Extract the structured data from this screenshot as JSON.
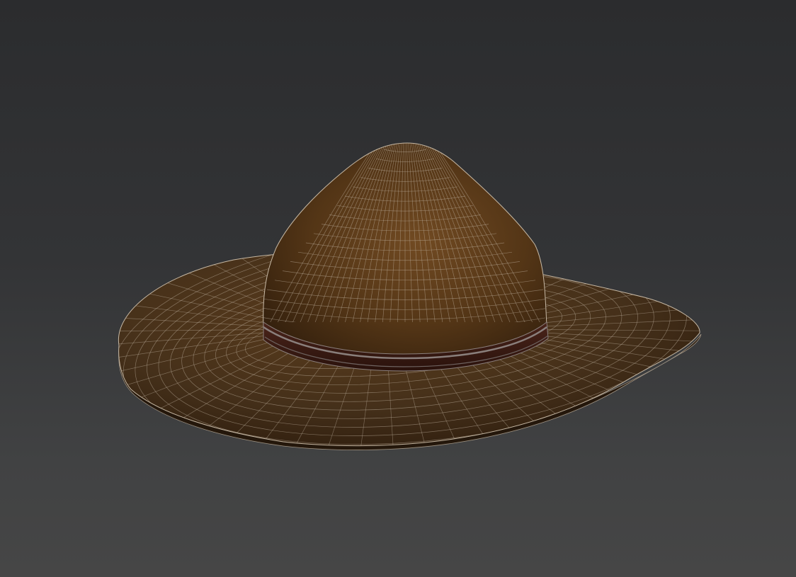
{
  "viewport": {
    "background_top": "#2b2c2e",
    "background_bottom": "#464646"
  },
  "model": {
    "object": "campaign-hat",
    "display_mode": "shaded-wireframe",
    "colors": {
      "crown_light": "#6a4520",
      "crown_base": "#4a2f14",
      "crown_dark": "#2f1d0c",
      "brim_top": "#4f3418",
      "brim_dark": "#2a190b",
      "band": "#3a1c14",
      "band_stripe": "#8a7f7c",
      "wire": "#b9ab99"
    }
  }
}
